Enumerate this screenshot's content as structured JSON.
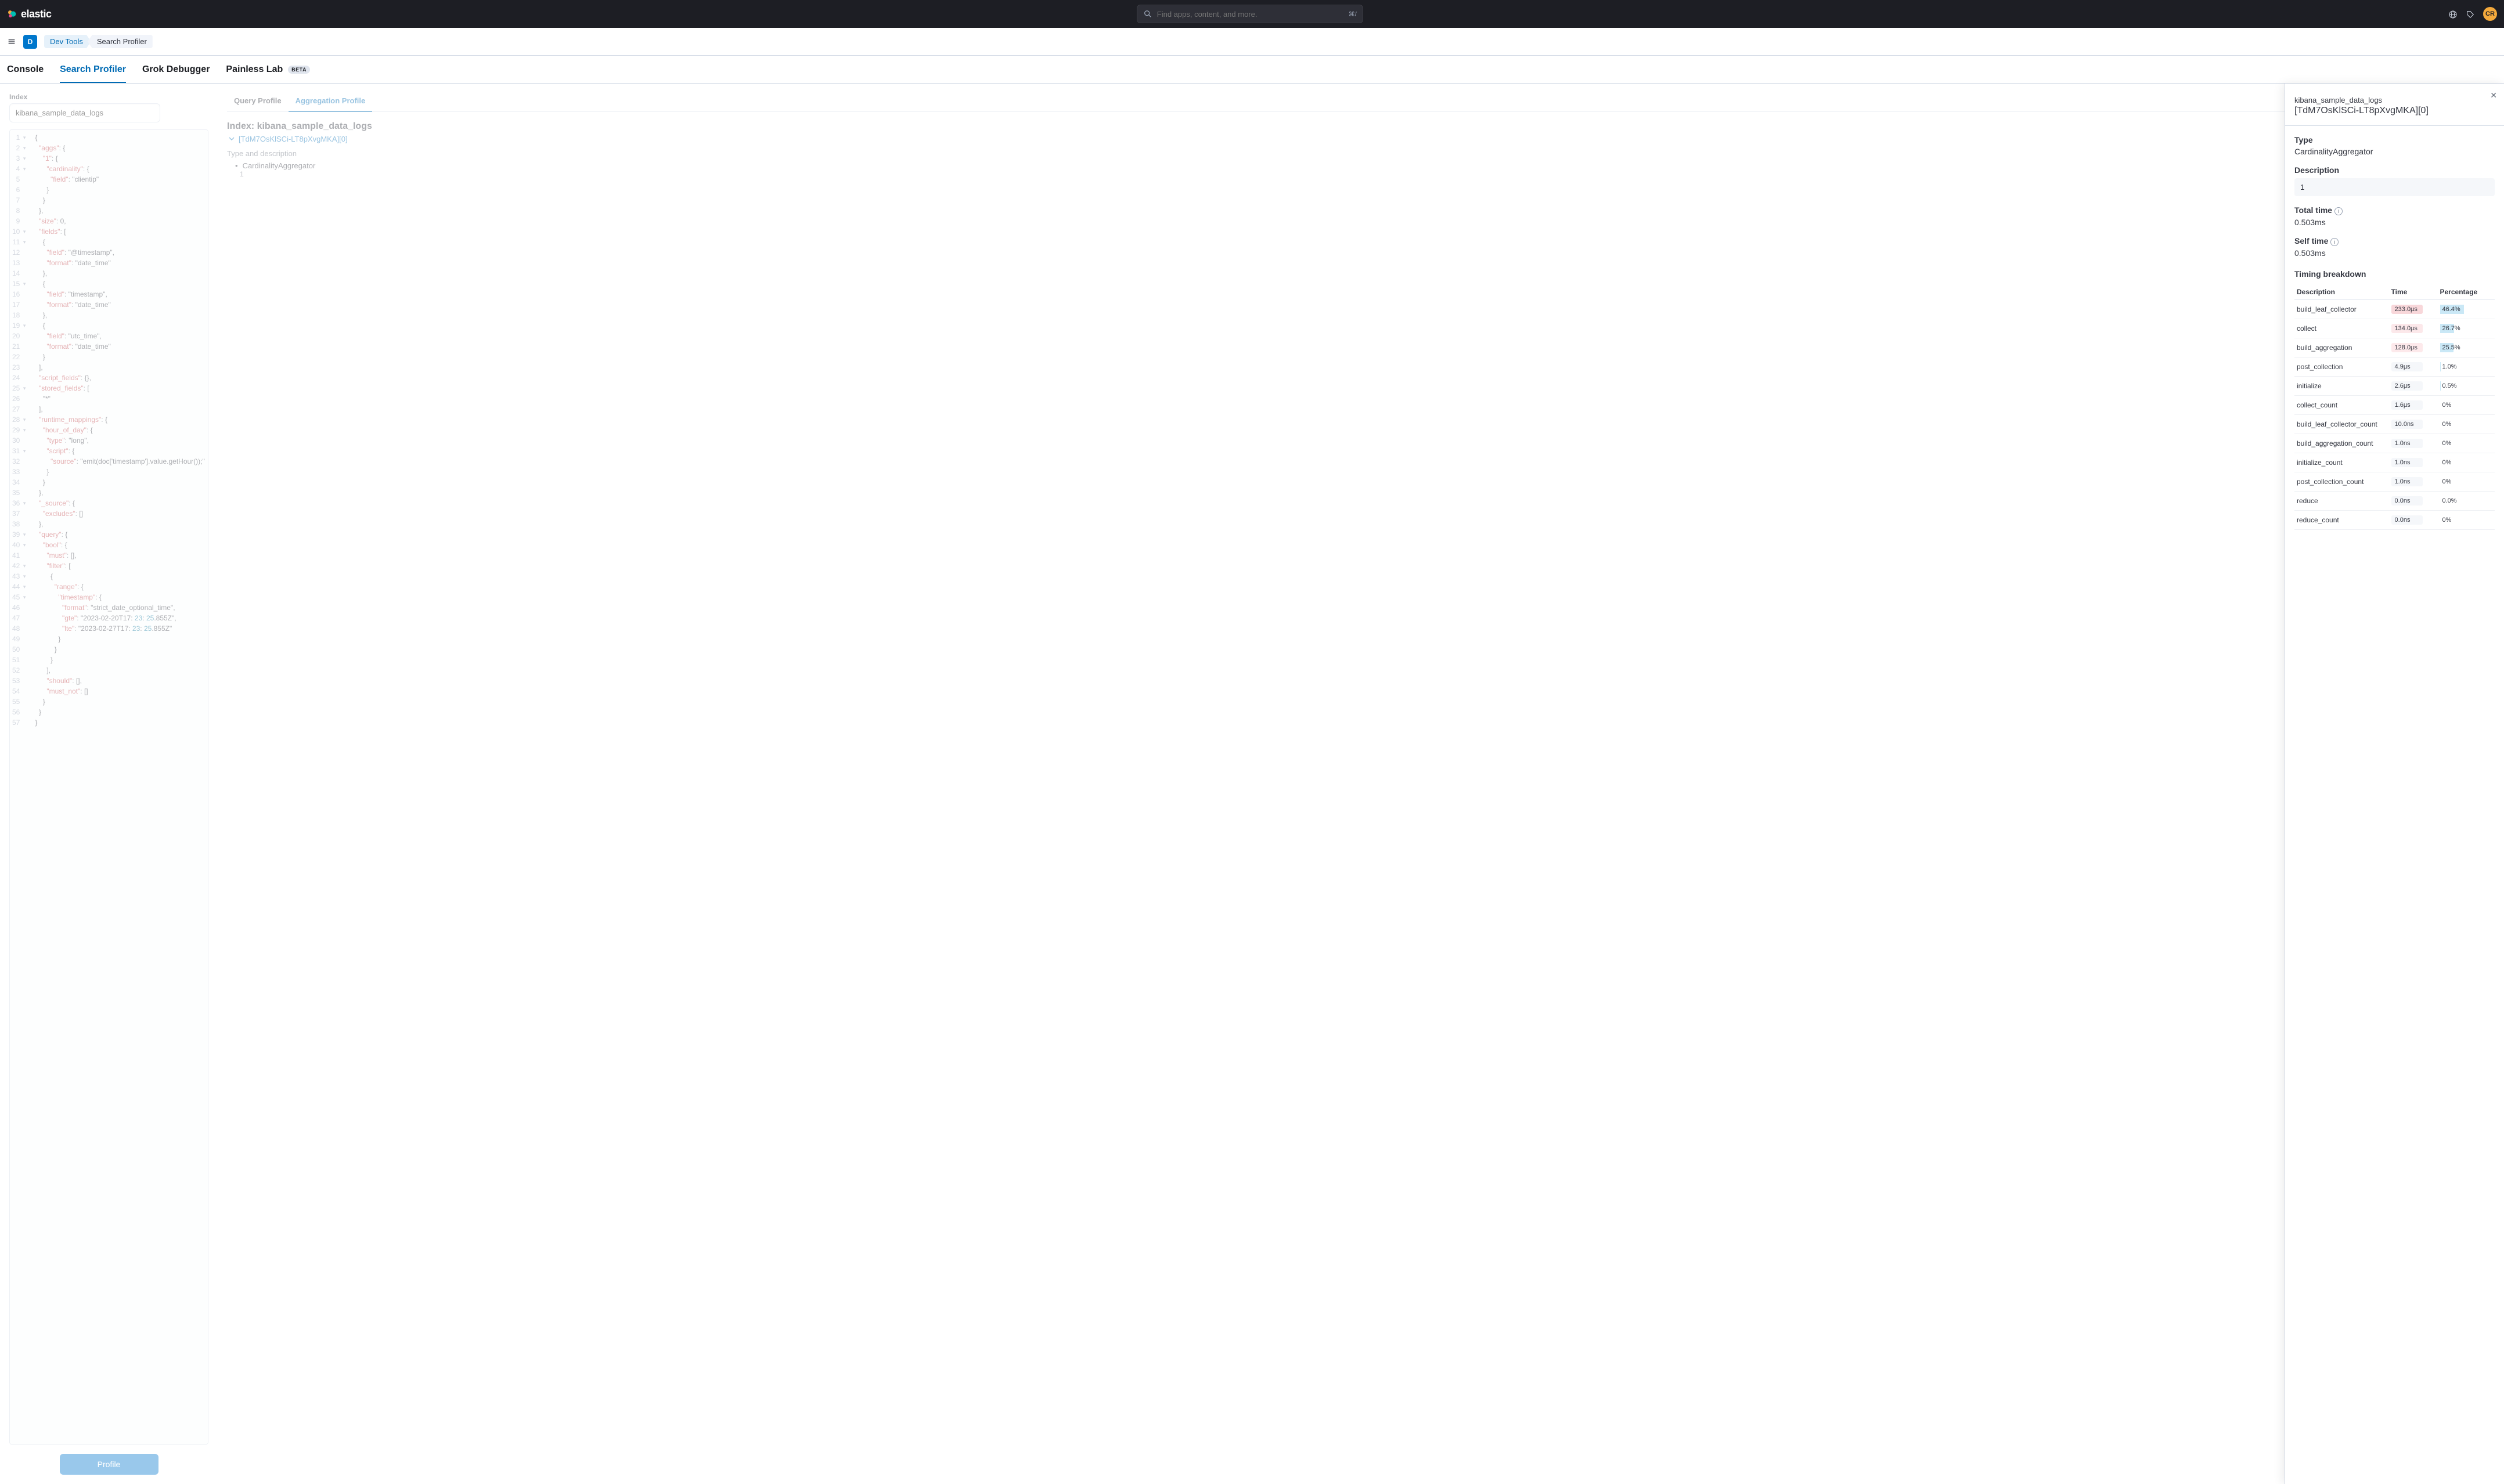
{
  "header": {
    "search_placeholder": "Find apps, content, and more.",
    "kbd_hint": "⌘/",
    "avatar_initials": "CR"
  },
  "breadcrumb": {
    "home_badge": "D",
    "first": "Dev Tools",
    "last": "Search Profiler"
  },
  "tools_tabs": {
    "console": "Console",
    "search_profiler": "Search Profiler",
    "grok": "Grok Debugger",
    "painless": "Painless Lab",
    "beta": "BETA"
  },
  "profiler": {
    "index_label": "Index",
    "index_value": "kibana_sample_data_logs",
    "profile_button": "Profile",
    "tab_query": "Query Profile",
    "tab_agg": "Aggregation Profile",
    "index_heading_prefix": "Index: ",
    "index_heading_value": "kibana_sample_data_logs",
    "shard_link": "[TdM7OsKlSCi-LT8pXvgMKA][0]",
    "type_and_desc": "Type and description",
    "agg_item": "CardinalityAggregator",
    "agg_sub": "1"
  },
  "editor": {
    "lines": [
      {
        "n": "1",
        "f": "▾",
        "t": "{"
      },
      {
        "n": "2",
        "f": "▾",
        "t": "  \"aggs\": {"
      },
      {
        "n": "3",
        "f": "▾",
        "t": "    \"1\": {"
      },
      {
        "n": "4",
        "f": "▾",
        "t": "      \"cardinality\": {"
      },
      {
        "n": "5",
        "f": "",
        "t": "        \"field\": \"clientip\""
      },
      {
        "n": "6",
        "f": "",
        "t": "      }"
      },
      {
        "n": "7",
        "f": "",
        "t": "    }"
      },
      {
        "n": "8",
        "f": "",
        "t": "  },"
      },
      {
        "n": "9",
        "f": "",
        "t": "  \"size\": 0,"
      },
      {
        "n": "10",
        "f": "▾",
        "t": "  \"fields\": ["
      },
      {
        "n": "11",
        "f": "▾",
        "t": "    {"
      },
      {
        "n": "12",
        "f": "",
        "t": "      \"field\": \"@timestamp\","
      },
      {
        "n": "13",
        "f": "",
        "t": "      \"format\": \"date_time\""
      },
      {
        "n": "14",
        "f": "",
        "t": "    },"
      },
      {
        "n": "15",
        "f": "▾",
        "t": "    {"
      },
      {
        "n": "16",
        "f": "",
        "t": "      \"field\": \"timestamp\","
      },
      {
        "n": "17",
        "f": "",
        "t": "      \"format\": \"date_time\""
      },
      {
        "n": "18",
        "f": "",
        "t": "    },"
      },
      {
        "n": "19",
        "f": "▾",
        "t": "    {"
      },
      {
        "n": "20",
        "f": "",
        "t": "      \"field\": \"utc_time\","
      },
      {
        "n": "21",
        "f": "",
        "t": "      \"format\": \"date_time\""
      },
      {
        "n": "22",
        "f": "",
        "t": "    }"
      },
      {
        "n": "23",
        "f": "",
        "t": "  ],"
      },
      {
        "n": "24",
        "f": "",
        "t": "  \"script_fields\": {},"
      },
      {
        "n": "25",
        "f": "▾",
        "t": "  \"stored_fields\": ["
      },
      {
        "n": "26",
        "f": "",
        "t": "    \"*\""
      },
      {
        "n": "27",
        "f": "",
        "t": "  ],"
      },
      {
        "n": "28",
        "f": "▾",
        "t": "  \"runtime_mappings\": {"
      },
      {
        "n": "29",
        "f": "▾",
        "t": "    \"hour_of_day\": {"
      },
      {
        "n": "30",
        "f": "",
        "t": "      \"type\": \"long\","
      },
      {
        "n": "31",
        "f": "▾",
        "t": "      \"script\": {"
      },
      {
        "n": "32",
        "f": "",
        "t": "        \"source\": \"emit(doc['timestamp'].value.getHour());\""
      },
      {
        "n": "33",
        "f": "",
        "t": "      }"
      },
      {
        "n": "34",
        "f": "",
        "t": "    }"
      },
      {
        "n": "35",
        "f": "",
        "t": "  },"
      },
      {
        "n": "36",
        "f": "▾",
        "t": "  \"_source\": {"
      },
      {
        "n": "37",
        "f": "",
        "t": "    \"excludes\": []"
      },
      {
        "n": "38",
        "f": "",
        "t": "  },"
      },
      {
        "n": "39",
        "f": "▾",
        "t": "  \"query\": {"
      },
      {
        "n": "40",
        "f": "▾",
        "t": "    \"bool\": {"
      },
      {
        "n": "41",
        "f": "",
        "t": "      \"must\": [],"
      },
      {
        "n": "42",
        "f": "▾",
        "t": "      \"filter\": ["
      },
      {
        "n": "43",
        "f": "▾",
        "t": "        {"
      },
      {
        "n": "44",
        "f": "▾",
        "t": "          \"range\": {"
      },
      {
        "n": "45",
        "f": "▾",
        "t": "            \"timestamp\": {"
      },
      {
        "n": "46",
        "f": "",
        "t": "              \"format\": \"strict_date_optional_time\","
      },
      {
        "n": "47",
        "f": "",
        "t": "              \"gte\": \"2023-02-20T17:23:25.855Z\","
      },
      {
        "n": "48",
        "f": "",
        "t": "              \"lte\": \"2023-02-27T17:23:25.855Z\""
      },
      {
        "n": "49",
        "f": "",
        "t": "            }"
      },
      {
        "n": "50",
        "f": "",
        "t": "          }"
      },
      {
        "n": "51",
        "f": "",
        "t": "        }"
      },
      {
        "n": "52",
        "f": "",
        "t": "      ],"
      },
      {
        "n": "53",
        "f": "",
        "t": "      \"should\": [],"
      },
      {
        "n": "54",
        "f": "",
        "t": "      \"must_not\": []"
      },
      {
        "n": "55",
        "f": "",
        "t": "    }"
      },
      {
        "n": "56",
        "f": "",
        "t": "  }"
      },
      {
        "n": "57",
        "f": "",
        "t": "}"
      }
    ]
  },
  "flyout": {
    "title_index": "kibana_sample_data_logs",
    "title_shard": "[TdM7OsKlSCi-LT8pXvgMKA][0]",
    "type_label": "Type",
    "type_value": "CardinalityAggregator",
    "desc_label": "Description",
    "desc_value": "1",
    "total_label": "Total time",
    "total_value": "0.503ms",
    "self_label": "Self time",
    "self_value": "0.503ms",
    "breakdown_label": "Timing breakdown",
    "th_desc": "Description",
    "th_time": "Time",
    "th_pct": "Percentage",
    "rows": [
      {
        "desc": "build_leaf_collector",
        "time": "233.0µs",
        "pct": "46.4%",
        "pctv": 46.4,
        "heat": "hot1"
      },
      {
        "desc": "collect",
        "time": "134.0µs",
        "pct": "26.7%",
        "pctv": 26.7,
        "heat": "hot2"
      },
      {
        "desc": "build_aggregation",
        "time": "128.0µs",
        "pct": "25.5%",
        "pctv": 25.5,
        "heat": "hot3"
      },
      {
        "desc": "post_collection",
        "time": "4.9µs",
        "pct": "1.0%",
        "pctv": 1.0,
        "heat": ""
      },
      {
        "desc": "initialize",
        "time": "2.6µs",
        "pct": "0.5%",
        "pctv": 0.5,
        "heat": ""
      },
      {
        "desc": "collect_count",
        "time": "1.6µs",
        "pct": "0%",
        "pctv": 0,
        "heat": ""
      },
      {
        "desc": "build_leaf_collector_count",
        "time": "10.0ns",
        "pct": "0%",
        "pctv": 0,
        "heat": ""
      },
      {
        "desc": "build_aggregation_count",
        "time": "1.0ns",
        "pct": "0%",
        "pctv": 0,
        "heat": ""
      },
      {
        "desc": "initialize_count",
        "time": "1.0ns",
        "pct": "0%",
        "pctv": 0,
        "heat": ""
      },
      {
        "desc": "post_collection_count",
        "time": "1.0ns",
        "pct": "0%",
        "pctv": 0,
        "heat": ""
      },
      {
        "desc": "reduce",
        "time": "0.0ns",
        "pct": "0.0%",
        "pctv": 0,
        "heat": ""
      },
      {
        "desc": "reduce_count",
        "time": "0.0ns",
        "pct": "0%",
        "pctv": 0,
        "heat": ""
      }
    ]
  }
}
